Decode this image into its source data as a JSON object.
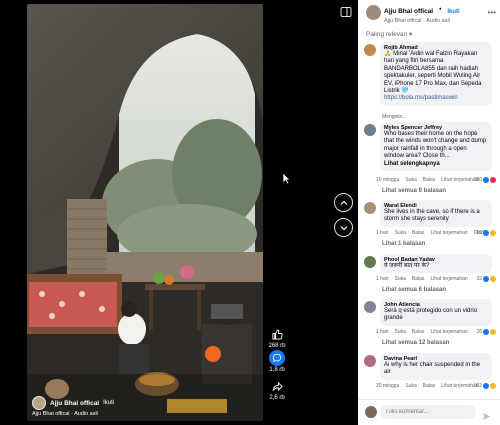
{
  "post": {
    "author": "Ajju Bhai offical",
    "follow": "Ikuti",
    "audio": "Ajju Bhai offical · Audio asli"
  },
  "actions": [
    {
      "icon": "like-icon",
      "count": "268 rb"
    },
    {
      "icon": "comment-icon",
      "count": "1,8 rb"
    },
    {
      "icon": "share-icon",
      "count": "2,6 rb"
    }
  ],
  "comments": {
    "sort_label": "Paling relevan",
    "items": [
      {
        "author": "Rojib Ahmad",
        "text": "🙏 Minal 'Aidin wal Faizin Rayakan hari yang fitri bersama BANDARBOLA855 dan raih hadiah spektakuler, seperti Mobil Wuling Air EV, iPhone 17 Pro Max, dan Sepeda Listrik 🩵",
        "link": "https://bola.ms/pastimaswin",
        "meta": [
          "Mengelin..."
        ]
      },
      {
        "author": "Myles Spencer Jeffrey",
        "text": "Who bases their home on the hope that the winds won't change and dump major rainfall in through a open window area? Close th...",
        "see_more": "Lihat selengkapnya",
        "meta": [
          "10 minggu",
          "Suka",
          "Balas",
          "Lihat terjemahan"
        ],
        "reactions": "180",
        "replies": "Lihat semua 9 balasan"
      },
      {
        "author": "Waral Elendi",
        "text": "She lives in the cave, so if there is a storm she stays serenity",
        "meta": [
          "1 hari",
          "Suka",
          "Balas",
          "Lihat terjemahan",
          "Diedit"
        ],
        "reactions": "69",
        "replies": "Lihat 1 balasan"
      },
      {
        "author": "Phool Badan Yadav",
        "text": "ये जरूरी बात पर के?",
        "meta": [
          "1 hari",
          "Suka",
          "Balas",
          "Lihat terjemahan"
        ],
        "reactions": "32",
        "replies": "Lihat semua 6 balasan"
      },
      {
        "author": "John Atiencia",
        "text": "Será q está protegido con un vidrio grande",
        "meta": [
          "1 hari",
          "Suka",
          "Balas",
          "Lihat terjemahan"
        ],
        "reactions": "26",
        "replies": "Lihat semua 12 balasan"
      },
      {
        "author": "Davina Pearl",
        "text": "Ai why is her chair suspended in the air",
        "meta": [
          "20 minggu",
          "Suka",
          "Balas",
          "Lihat terjemahan"
        ],
        "reactions": "102"
      }
    ],
    "composer_placeholder": "Tulis komentar..."
  },
  "colors": {
    "facebook_blue": "#1877f2",
    "like_blue": "#1877f2",
    "love_red": "#f02849",
    "haha_yellow": "#f7b928"
  }
}
